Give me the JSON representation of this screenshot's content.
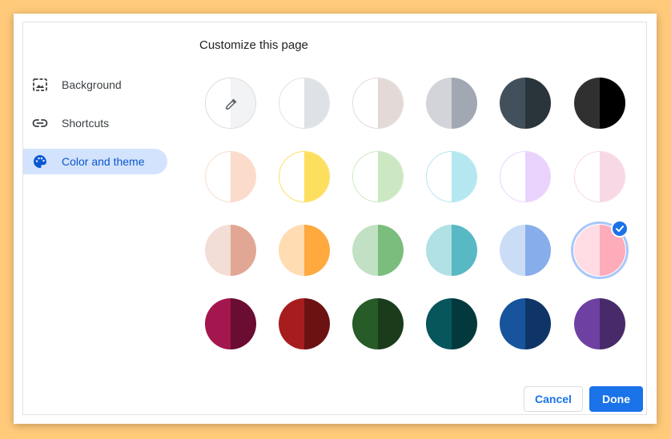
{
  "dialog": {
    "title": "Customize this page"
  },
  "nav": [
    {
      "label": "Background",
      "icon": "background-image-icon",
      "active": false
    },
    {
      "label": "Shortcuts",
      "icon": "link-icon",
      "active": false
    },
    {
      "label": "Color and theme",
      "icon": "palette-icon",
      "active": true
    }
  ],
  "swatches": [
    [
      {
        "name": "custom-color",
        "left": "#ffffff",
        "right": "#f1f3f4",
        "icon": "eyedropper-icon"
      },
      {
        "name": "default-grey-light",
        "left": "#ffffff",
        "right": "#dee1e6"
      },
      {
        "name": "warm-grey",
        "left": "#ffffff",
        "right": "#e3dad7"
      },
      {
        "name": "cool-grey",
        "left": "#d2d4da",
        "right": "#a2a7b4"
      },
      {
        "name": "blue-grey",
        "left": "#42505b",
        "right": "#2a343b"
      },
      {
        "name": "black",
        "left": "#303030",
        "right": "#000000"
      }
    ],
    [
      {
        "name": "beige-light",
        "left": "#ffffff",
        "right": "#fbdbca"
      },
      {
        "name": "yellow-light",
        "left": "#ffffff",
        "right": "#fddf5f"
      },
      {
        "name": "green-light",
        "left": "#ffffff",
        "right": "#cbe8c3"
      },
      {
        "name": "cyan-light",
        "left": "#ffffff",
        "right": "#b4e7f0"
      },
      {
        "name": "lavender-light",
        "left": "#ffffff",
        "right": "#e9d3fd"
      },
      {
        "name": "pink-light",
        "left": "#ffffff",
        "right": "#f8d8e5"
      }
    ],
    [
      {
        "name": "beige",
        "left": "#f3ddd7",
        "right": "#e2a794"
      },
      {
        "name": "orange",
        "left": "#ffdcb2",
        "right": "#ffa93f"
      },
      {
        "name": "green",
        "left": "#c2e1c4",
        "right": "#7bbd7c"
      },
      {
        "name": "cyan",
        "left": "#b1e1e4",
        "right": "#58b8c4"
      },
      {
        "name": "light-blue",
        "left": "#cadcf6",
        "right": "#87aeeb"
      },
      {
        "name": "light-pink",
        "left": "#ffdce4",
        "right": "#feabba",
        "selected": true
      }
    ],
    [
      {
        "name": "dark-pink-red",
        "left": "#a3164e",
        "right": "#6b0c32"
      },
      {
        "name": "dark-red-orange",
        "left": "#a71d1d",
        "right": "#6d1212"
      },
      {
        "name": "dark-green",
        "left": "#275b28",
        "right": "#1a3c1b"
      },
      {
        "name": "dark-cyan",
        "left": "#06565c",
        "right": "#03393d"
      },
      {
        "name": "dark-blue",
        "left": "#18549c",
        "right": "#0e3566"
      },
      {
        "name": "dark-purple",
        "left": "#6d40a1",
        "right": "#482a6b"
      }
    ]
  ],
  "buttons": {
    "cancel": "Cancel",
    "done": "Done"
  }
}
